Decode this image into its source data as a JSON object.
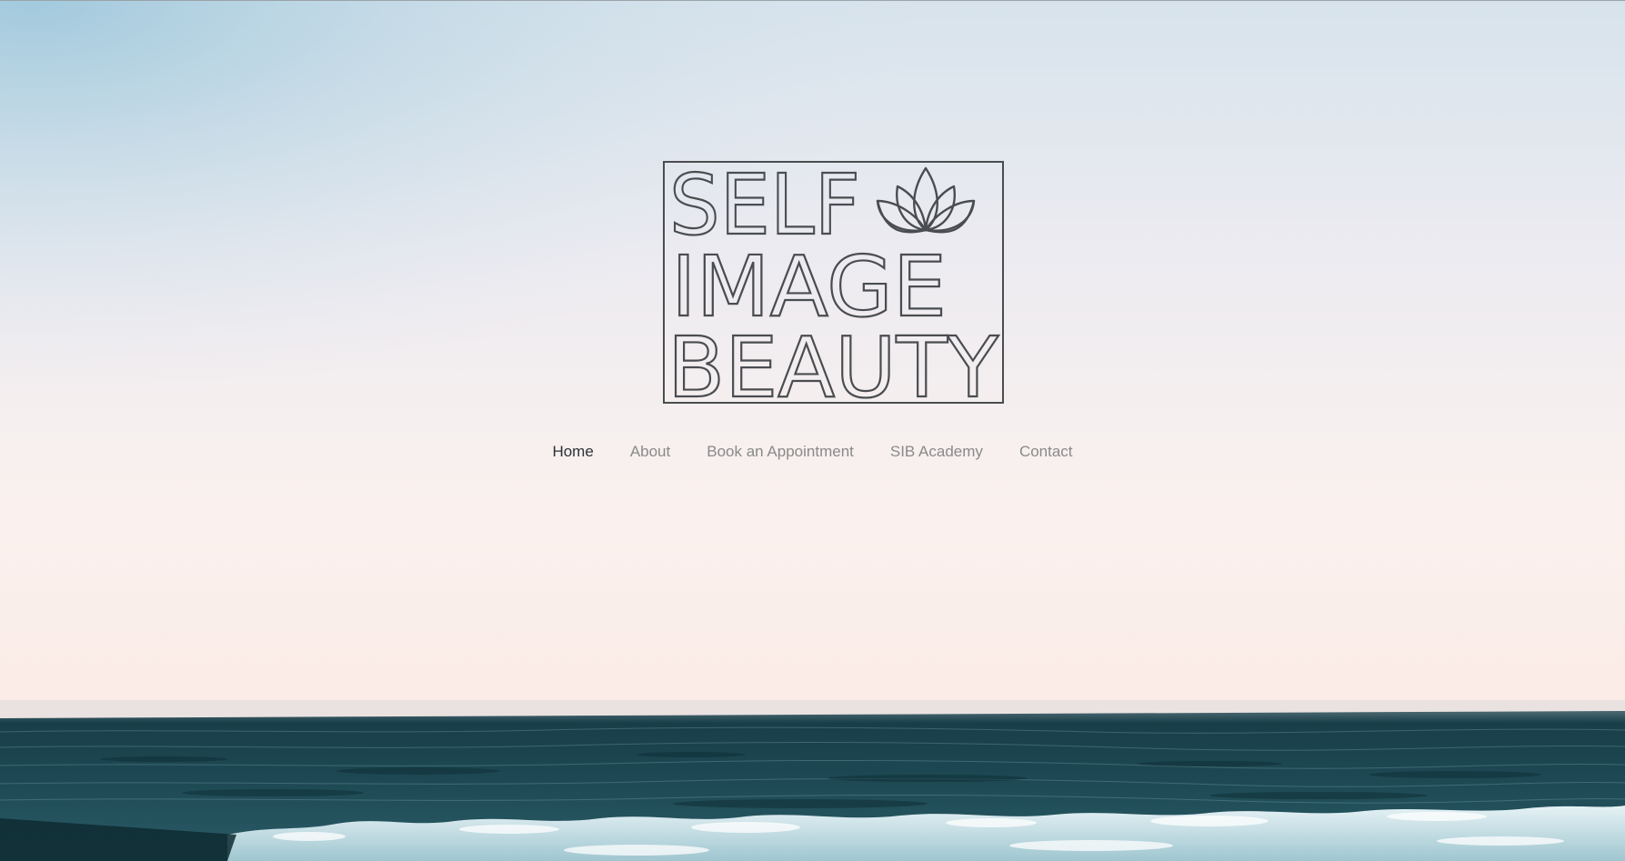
{
  "logo": {
    "line1": "SELF",
    "line2": "IMAGE",
    "line3": "BEAUTY",
    "icon": "lotus-icon"
  },
  "nav": {
    "items": [
      {
        "label": "Home",
        "active": true
      },
      {
        "label": "About",
        "active": false
      },
      {
        "label": "Book an Appointment",
        "active": false
      },
      {
        "label": "SIB Academy",
        "active": false
      },
      {
        "label": "Contact",
        "active": false
      }
    ]
  },
  "colors": {
    "logo_ink": "#4a4d50",
    "nav_active": "#2a3236",
    "nav_inactive": "#8a8a8a",
    "sky_top": "#b8d6e3",
    "sky_bottom": "#fbf1ec",
    "sea": "#1d4a55"
  }
}
